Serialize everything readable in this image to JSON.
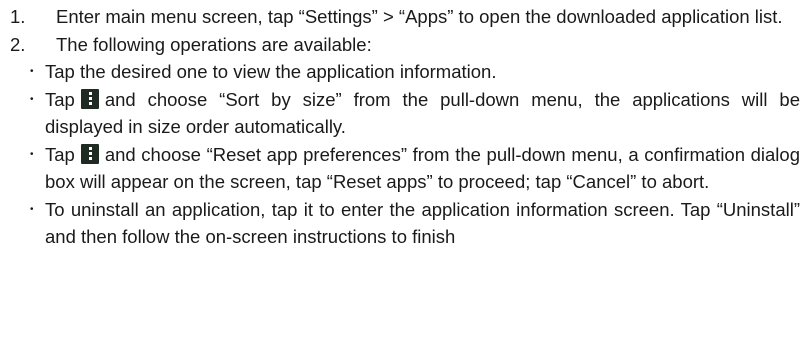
{
  "steps": [
    {
      "number": "1.",
      "text": "Enter main menu screen, tap “Settings” > “Apps” to open the downloaded application list."
    },
    {
      "number": "2.",
      "text": "The following operations are available:",
      "items": [
        {
          "text": "Tap the desired one to view the application information."
        },
        {
          "before": "Tap",
          "icon": "menu-icon",
          "after": "and choose “Sort by size” from the pull-down menu, the applications will be displayed in size order automatically."
        },
        {
          "before": "Tap",
          "icon": "menu-icon",
          "after": "and choose “Reset app preferences” from the pull-down menu, a confirmation dialog box will appear on the screen, tap “Reset apps” to proceed; tap “Cancel” to abort."
        },
        {
          "text": "To uninstall an application, tap it to enter the application information screen. Tap “Uninstall” and then follow the on-screen instructions to finish"
        }
      ]
    }
  ],
  "bullet_glyph": "•"
}
